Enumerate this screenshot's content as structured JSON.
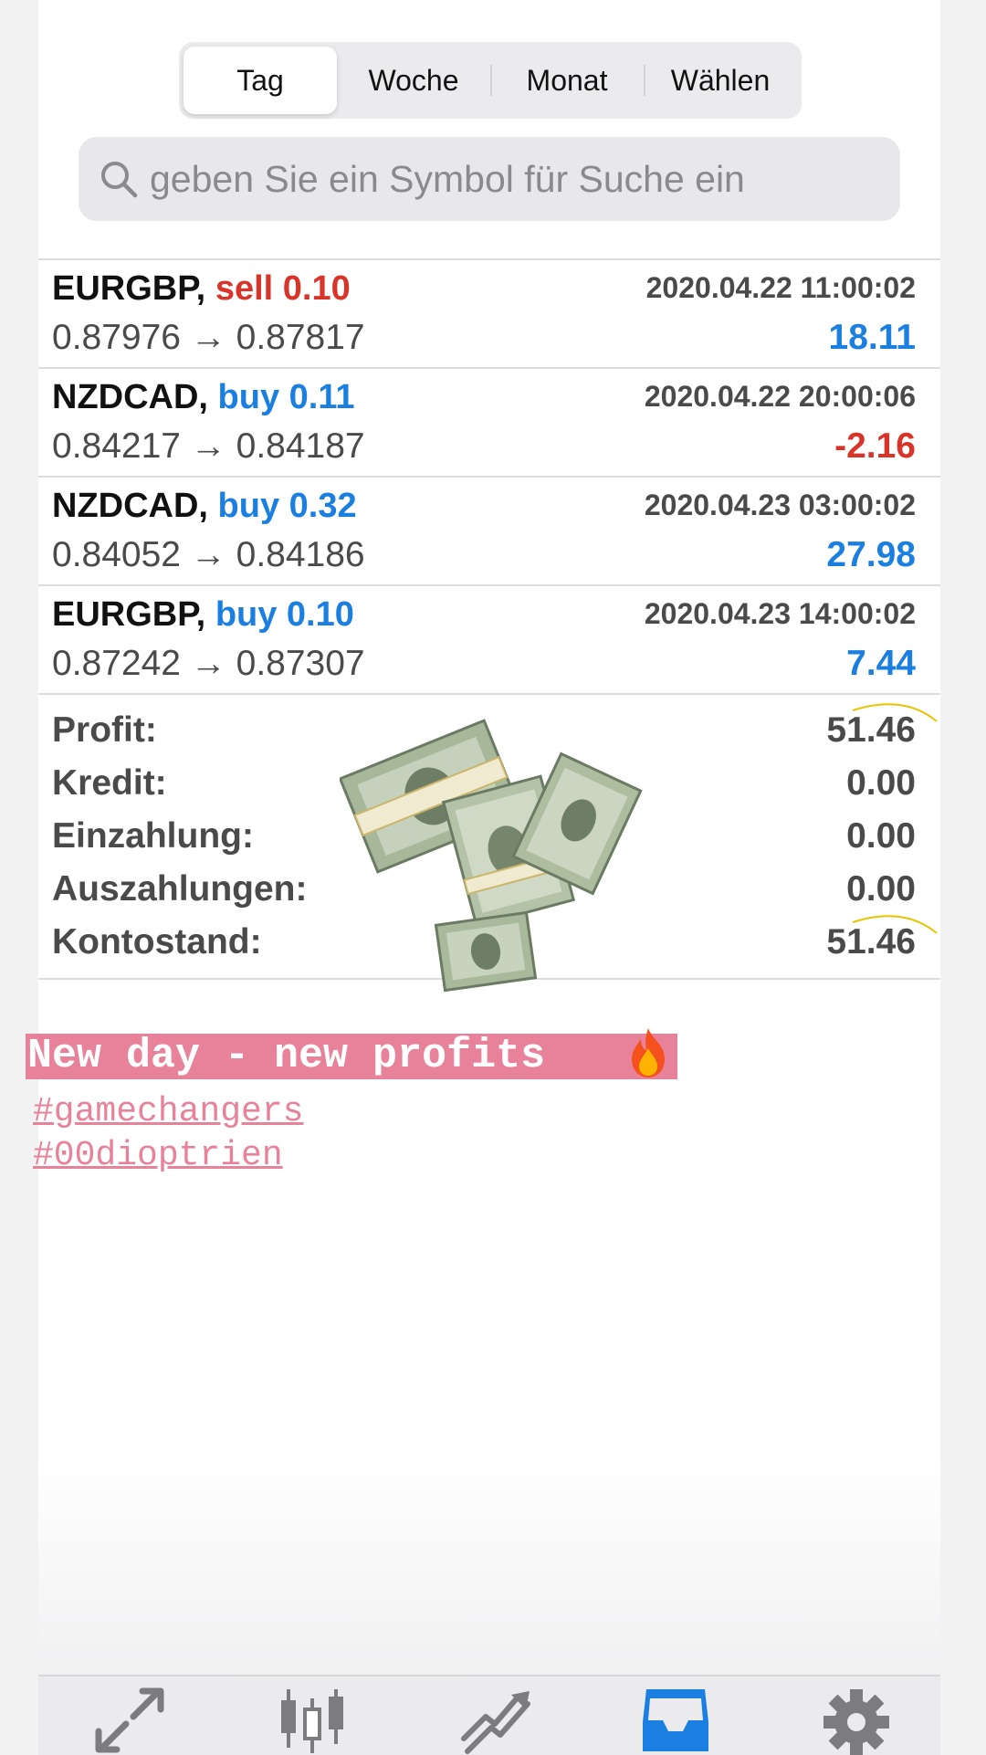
{
  "segments": [
    "Tag",
    "Woche",
    "Monat",
    "Wählen"
  ],
  "search": {
    "placeholder": "geben Sie ein Symbol für Suche ein"
  },
  "trades": [
    {
      "symbol": "EURGBP,",
      "side": "sell 0.10",
      "time": "2020.04.22 11:00:02",
      "prices": "0.87976 → 0.87817",
      "profit": "18.11"
    },
    {
      "symbol": "NZDCAD,",
      "side": "buy 0.11",
      "time": "2020.04.22 20:00:06",
      "prices": "0.84217 → 0.84187",
      "profit": "-2.16"
    },
    {
      "symbol": "NZDCAD,",
      "side": "buy 0.32",
      "time": "2020.04.23 03:00:02",
      "prices": "0.84052 → 0.84186",
      "profit": "27.98"
    },
    {
      "symbol": "EURGBP,",
      "side": "buy 0.10",
      "time": "2020.04.23 14:00:02",
      "prices": "0.87242 → 0.87307",
      "profit": "7.44"
    }
  ],
  "summary": [
    {
      "label": "Profit:",
      "value": "51.46"
    },
    {
      "label": "Kredit:",
      "value": "0.00"
    },
    {
      "label": "Einzahlung:",
      "value": "0.00"
    },
    {
      "label": "Auszahlungen:",
      "value": "0.00"
    },
    {
      "label": "Kontostand:",
      "value": "51.46"
    }
  ],
  "story": {
    "caption": "New day - new profits",
    "hashtags": [
      "#gamechangers",
      "#00dioptrien"
    ],
    "caption_color": "#e8829a"
  },
  "tabbar": {
    "items": [
      "quotes-icon",
      "chart-icon",
      "trade-icon",
      "history-icon",
      "settings-icon"
    ],
    "active": "history-icon",
    "active_color": "#1a7fe0"
  },
  "colors": {
    "sell": "#d8342a",
    "buy": "#1a7fe0",
    "profit_positive": "#1a7fe0",
    "profit_negative": "#d8342a"
  }
}
